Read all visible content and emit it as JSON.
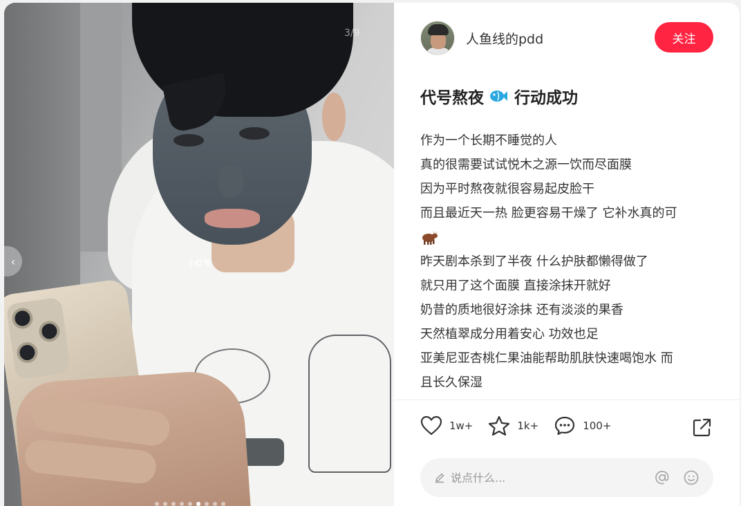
{
  "media": {
    "counter": "3/9",
    "watermark": "小红书",
    "slide_count": 9,
    "active_slide": 5
  },
  "author": {
    "name": "人鱼线的pdd",
    "follow_label": "关注"
  },
  "note": {
    "title_part1": "代号熬夜",
    "title_part2": "行动成功",
    "lines": [
      "作为一个长期不睡觉的人",
      "真的很需要试试悦木之源一饮而尽面膜",
      "因为平时熬夜就很容易起皮脸干",
      "而且最近天一热 脸更容易干燥了 它补水真的可",
      "",
      "昨天剧本杀到了半夜 什么护肤都懒得做了",
      "就只用了这个面膜 直接涂抹开就好",
      "奶昔的质地很好涂抹 还有淡淡的果香",
      "天然植翠成分用着安心 功效也足",
      "亚美尼亚杏桃仁果油能帮助肌肤快速喝饱水 而",
      "且长久保湿"
    ]
  },
  "engagement": {
    "likes": "1w+",
    "collects": "1k+",
    "comments": "100+"
  },
  "comment_input": {
    "placeholder": "说点什么..."
  },
  "colors": {
    "accent": "#ff2442",
    "fish_emoji": "#29a8e0",
    "text": "#333333"
  },
  "icons": [
    "like-icon",
    "collect-icon",
    "comment-icon",
    "share-icon",
    "pencil-icon",
    "mention-icon",
    "emoji-icon",
    "fish-emoji-icon",
    "cow-emoji-icon"
  ]
}
